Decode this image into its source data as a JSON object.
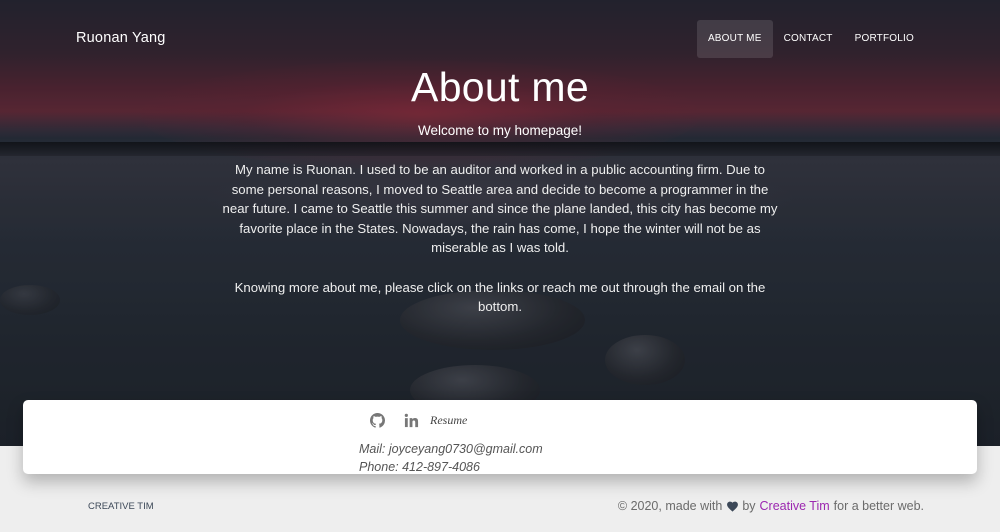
{
  "navbar": {
    "brand": "Ruonan Yang",
    "items": [
      {
        "label": "ABOUT ME",
        "active": true
      },
      {
        "label": "CONTACT",
        "active": false
      },
      {
        "label": "PORTFOLIO",
        "active": false
      }
    ]
  },
  "hero": {
    "title": "About me",
    "subtitle": "Welcome to my homepage!",
    "paragraphs": [
      "My name is Ruonan. I used to be an auditor and worked in a public accounting firm. Due to some personal reasons, I moved to Seattle area and decide to become a programmer in the near future. I came to Seattle this summer and since the plane landed, this city has become my favorite place in the States. Nowadays, the rain has come, I hope the winter will not be as miserable as I was told.",
      "Knowing more about me, please click on the links or reach me out through the email on the bottom."
    ]
  },
  "contact": {
    "icons": [
      "github-icon",
      "linkedin-icon"
    ],
    "resume_label": "Resume",
    "mail": "Mail: joyceyang0730@gmail.com",
    "phone": "Phone: 412-897-4086"
  },
  "footer": {
    "brand": "CREATIVE TIM",
    "copy_prefix": "© 2020, made with",
    "copy_by": "by",
    "copy_link": "Creative Tim",
    "copy_suffix": "for a better web.",
    "heart_icon": "heart-icon"
  },
  "colors": {
    "link_purple": "#9c27b0",
    "hero_overlay": "#2d3440"
  }
}
